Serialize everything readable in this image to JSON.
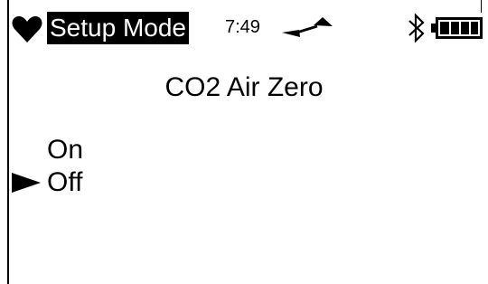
{
  "header": {
    "status_icon": "heart-icon",
    "mode_label": "Setup Mode",
    "time": "7:49",
    "pump_icon": "pump-icon",
    "bluetooth_icon": "bluetooth-icon",
    "battery": {
      "icon": "battery-icon",
      "level": 1.0
    }
  },
  "screen": {
    "title": "CO2 Air Zero",
    "options": [
      {
        "label": "On",
        "selected": false
      },
      {
        "label": "Off",
        "selected": true
      }
    ],
    "cursor_icon": "selection-arrow-icon"
  },
  "colors": {
    "background": "#ffffff",
    "foreground": "#000000"
  }
}
